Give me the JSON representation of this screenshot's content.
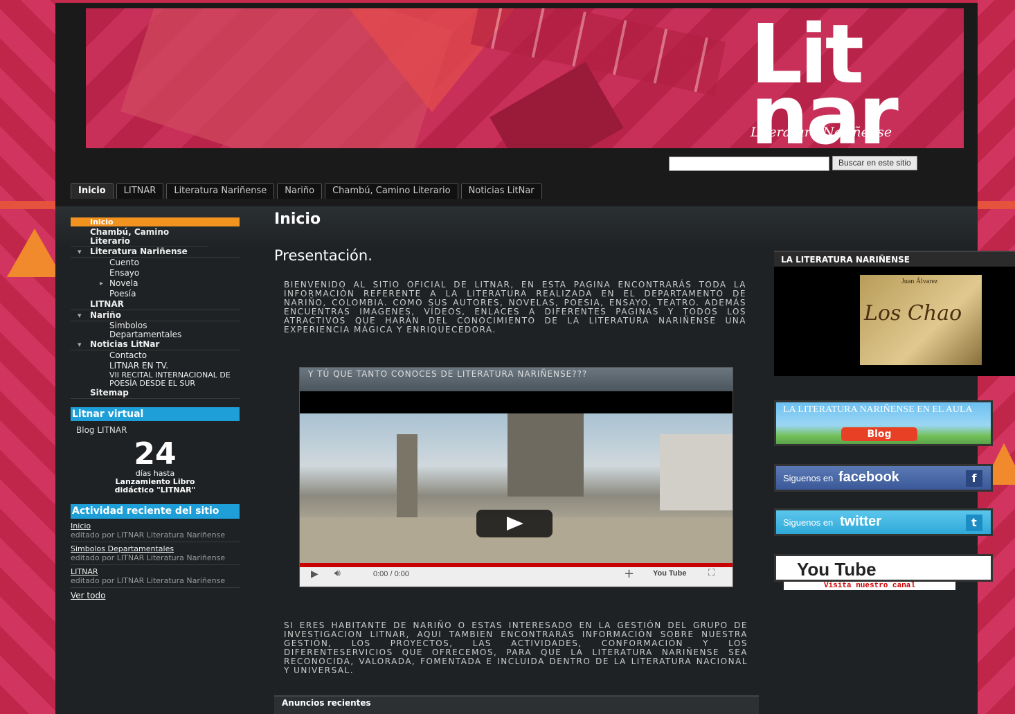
{
  "header": {
    "logo_text": "Lit nar",
    "logo_subtitle": "Literatura Nariñense",
    "search_button": "Buscar en este sitio"
  },
  "tabs": [
    {
      "label": "Inicio"
    },
    {
      "label": "LITNAR"
    },
    {
      "label": "Literatura Nariñense"
    },
    {
      "label": "Nariño"
    },
    {
      "label": "Chambú, Camino Literario"
    },
    {
      "label": "Noticias LitNar"
    }
  ],
  "sidebar": {
    "nav": {
      "inicio": "Inicio",
      "chambu": "Chambú, Camino Literario",
      "literatura": "Literatura Nariñense",
      "cuento": "Cuento",
      "ensayo": "Ensayo",
      "novela": "Novela",
      "poesia": "Poesía",
      "litnar": "LITNAR",
      "narino": "Nariño",
      "simbolos": "Simbolos Departamentales",
      "noticias": "Noticias LitNar",
      "contacto": "Contacto",
      "tv": "LITNAR EN TV.",
      "recital": "VII RECITAL INTERNACIONAL DE POESÍA DESDE EL SUR",
      "sitemap": "Sitemap"
    },
    "virtual": {
      "title": "Litnar virtual",
      "blog": "Blog LITNAR"
    },
    "countdown": {
      "number": "24",
      "line1": "días hasta",
      "line2": "Lanzamiento Libro",
      "line3": "didáctico \"LITNAR\""
    },
    "activity": {
      "title": "Actividad reciente del sitio",
      "items": [
        {
          "link": "Inicio",
          "meta": "editado por LITNAR Literatura Nariñense"
        },
        {
          "link": "Simbolos Departamentales",
          "meta": "editado por LITNAR Literatura Nariñense"
        },
        {
          "link": "LITNAR",
          "meta": "editado por LITNAR Literatura Nariñense"
        }
      ],
      "view_all": "Ver todo"
    }
  },
  "content": {
    "page_title": "Inicio",
    "heading": "Presentación.",
    "intro": "BIENVENIDO AL SITIO OFICIAL DE LITNAR, EN ESTA PAGINA ENCONTRARÁS TODA LA INFORMACIÓN REFERENTE A LA LITERATURA REALIZADA EN EL DEPARTAMENTO DE NARIÑO, COLOMBIA. COMO SUS AUTORES, NOVELAS, POESIA, ENSAYO, TEATRO. ADEMÁS ENCUENTRAS IMAGENES, VÍDEOS, ENLACES A DIFERENTES PAGINAS Y TODOS LOS ATRACTIVOS QUE HARÁN DEL CONOCIMIENTO DE LA LITERATURA NARIÑENSE UNA EXPERIENCIA MÁGICA Y ENRIQUECEDORA.",
    "video": {
      "title": "Y TÚ QUE TANTO CONOCES DE LITERATURA NARIÑENSE???",
      "time": "0:00 / 0:00",
      "youtube_label": "You Tube"
    },
    "second": "SI ERES HABITANTE DE NARIÑO O ESTAS INTERESADO EN LA GESTIÓN DEL GRUPO DE INVESTIGACION LITNAR, AQUI TAMBIEN ENCONTRARÁS INFORMACIÓN SOBRE NUESTRA GESTIÓN, LOS PROYECTOS, LAS ACTIVIDADES, CONFORMACIÓN Y LOS DIFERENTESERVICIOS QUE OFRECEMOS, PARA QUE LA LITERATURA NARIÑENSE SEA RECONOCIDA, VALORADA, FOMENTADA E INCLUIDA DENTRO DE LA LITERATURA NACIONAL Y UNIVERSAL.",
    "announcements": "Anuncios recientes"
  },
  "right": {
    "heading": "LA LITERATURA NARIÑENSE",
    "book_title": "Los Chao",
    "book_author": "Juan Álvarez",
    "aula_text": "LA LITERATURA NARIÑENSE EN EL AULA",
    "blog_text": "Blog",
    "facebook_text": "Siguenos en",
    "facebook_brand": "facebook",
    "twitter_text": "Siguenos en",
    "twitter_brand": "twitter",
    "youtube_text": "You Tube",
    "youtube_caption": "Visita nuestro canal"
  },
  "colors": {
    "accent_orange": "#f29320",
    "accent_blue": "#1e9fd8",
    "bg_crimson": "#c62a4c"
  }
}
